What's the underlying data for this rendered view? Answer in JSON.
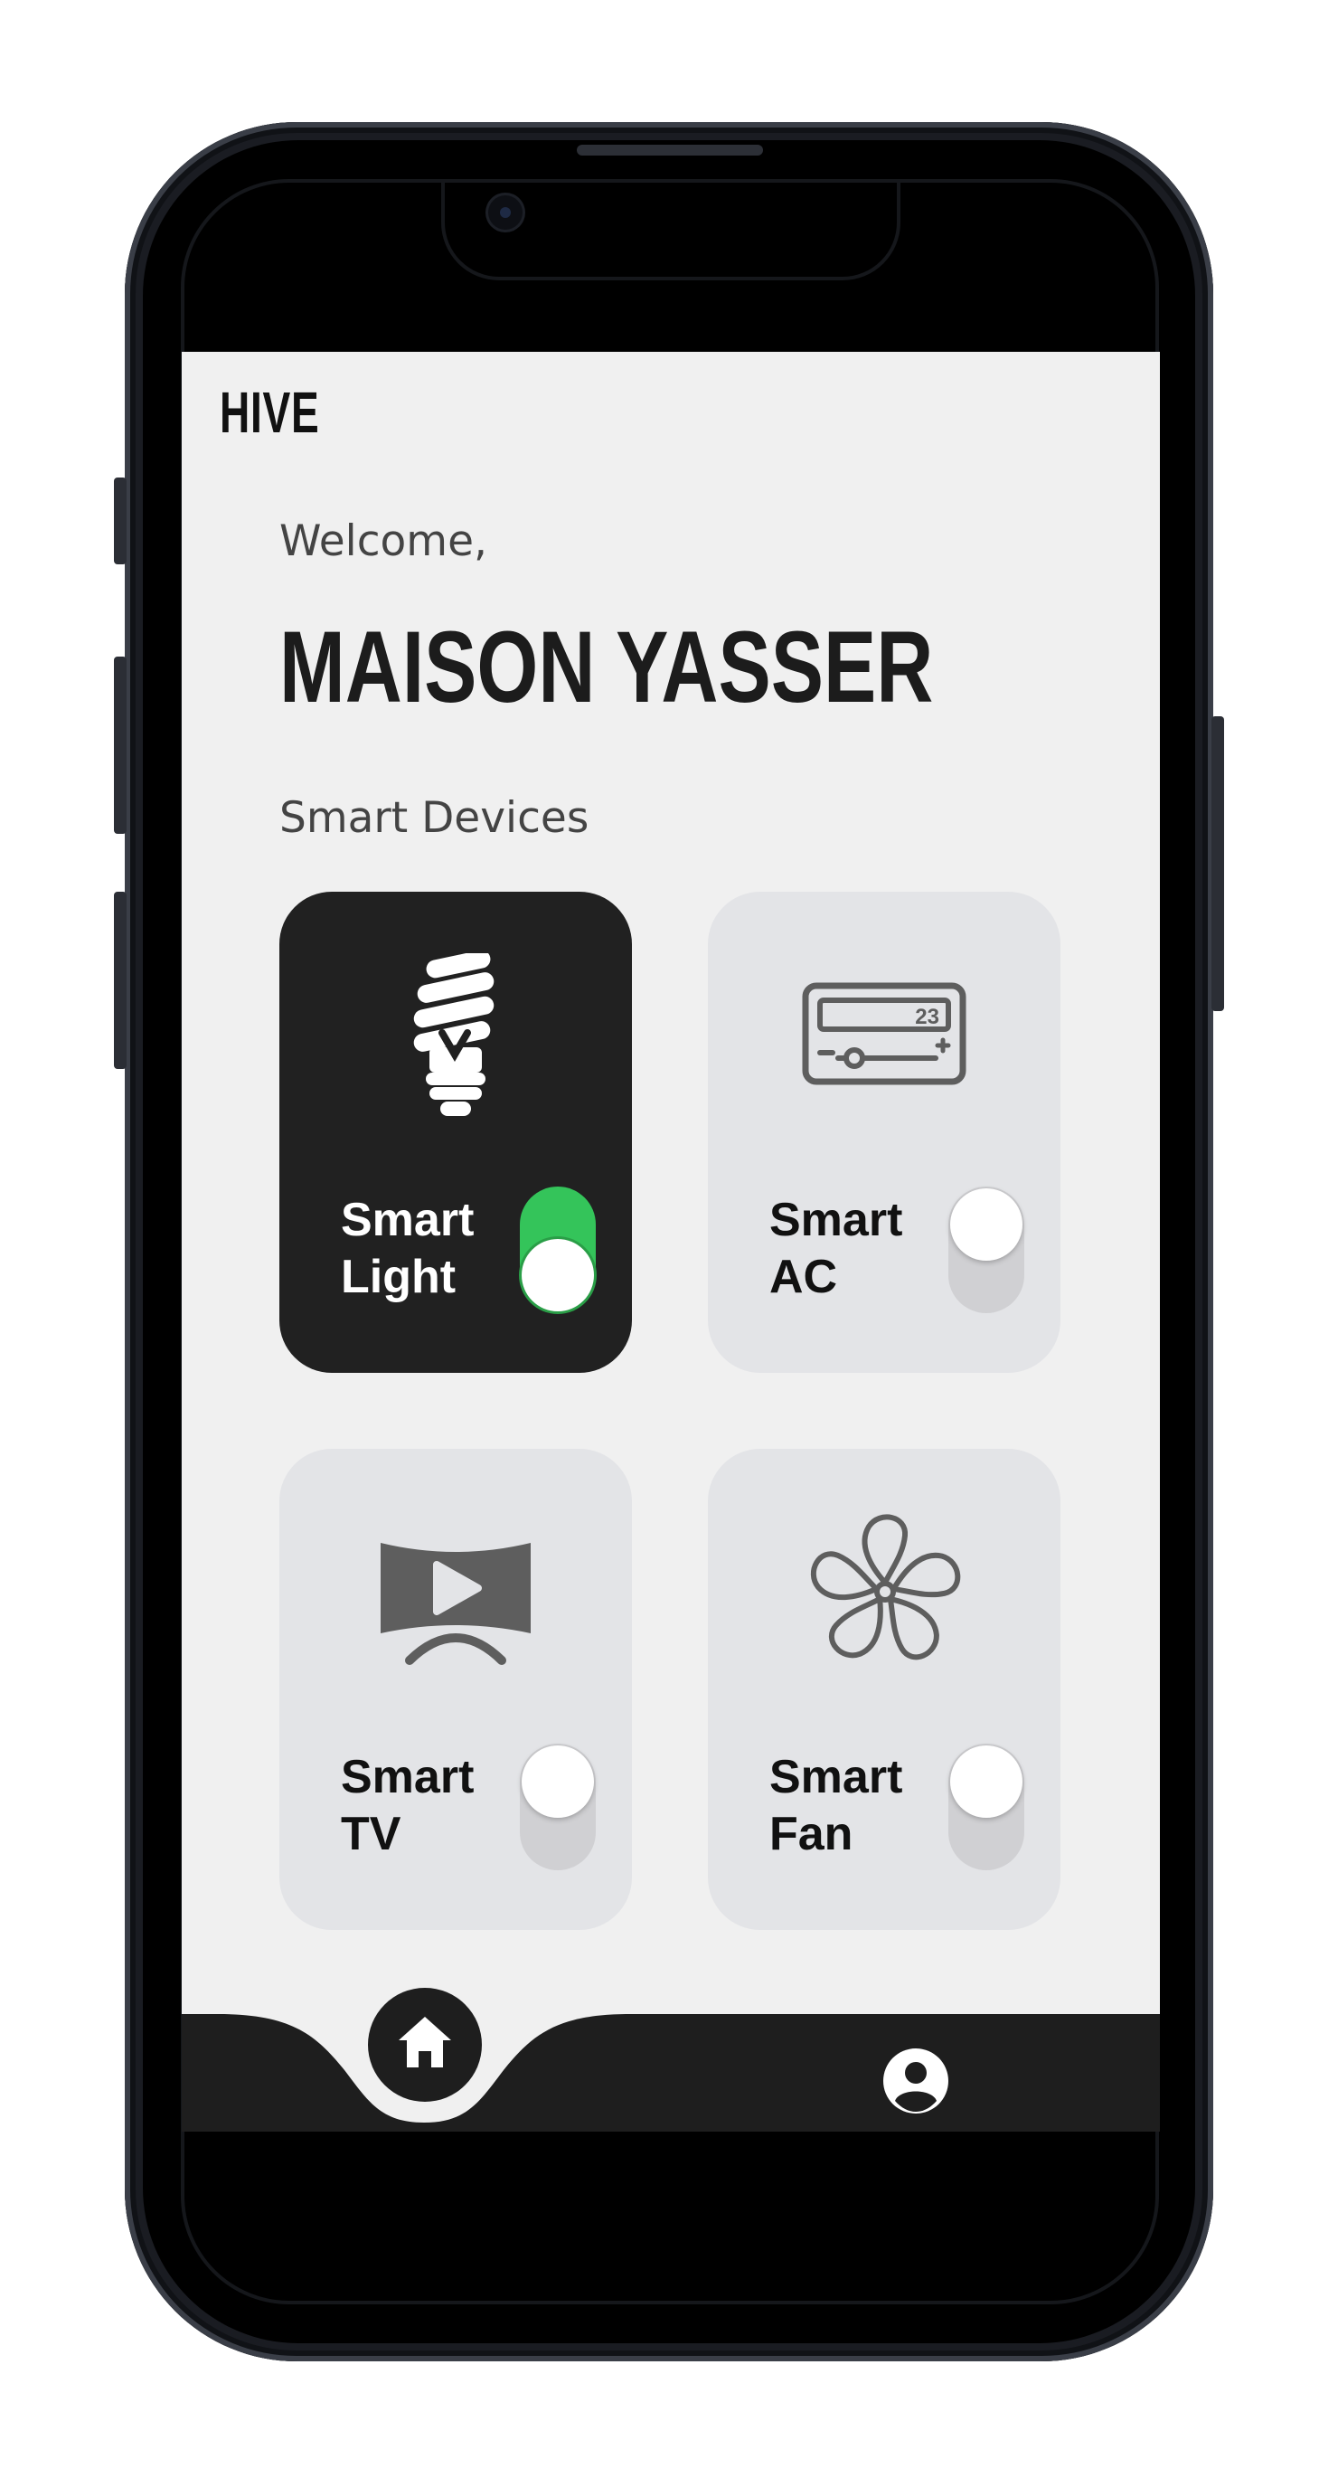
{
  "app": {
    "brand": "HIVE",
    "welcome": "Welcome,",
    "user_name": "MAISON YASSER",
    "section_title": "Smart Devices"
  },
  "devices": [
    {
      "label": "Smart Light",
      "icon": "light-bulb-icon",
      "on": true
    },
    {
      "label": "Smart AC",
      "icon": "air-conditioner-icon",
      "on": false,
      "display_value": "23"
    },
    {
      "label": "Smart TV",
      "icon": "tv-play-icon",
      "on": false
    },
    {
      "label": "Smart Fan",
      "icon": "fan-icon",
      "on": false
    }
  ],
  "nav": {
    "items": [
      {
        "icon": "home-icon",
        "active": true
      },
      {
        "icon": "profile-icon",
        "active": false
      }
    ]
  },
  "colors": {
    "screen_bg": "#f0f0f0",
    "card_bg": "#e3e4e7",
    "active_card_bg": "#212121",
    "toggle_on": "#34c45a",
    "toggle_off": "#d0d0d3",
    "nav_bg": "#1e1e1e"
  }
}
